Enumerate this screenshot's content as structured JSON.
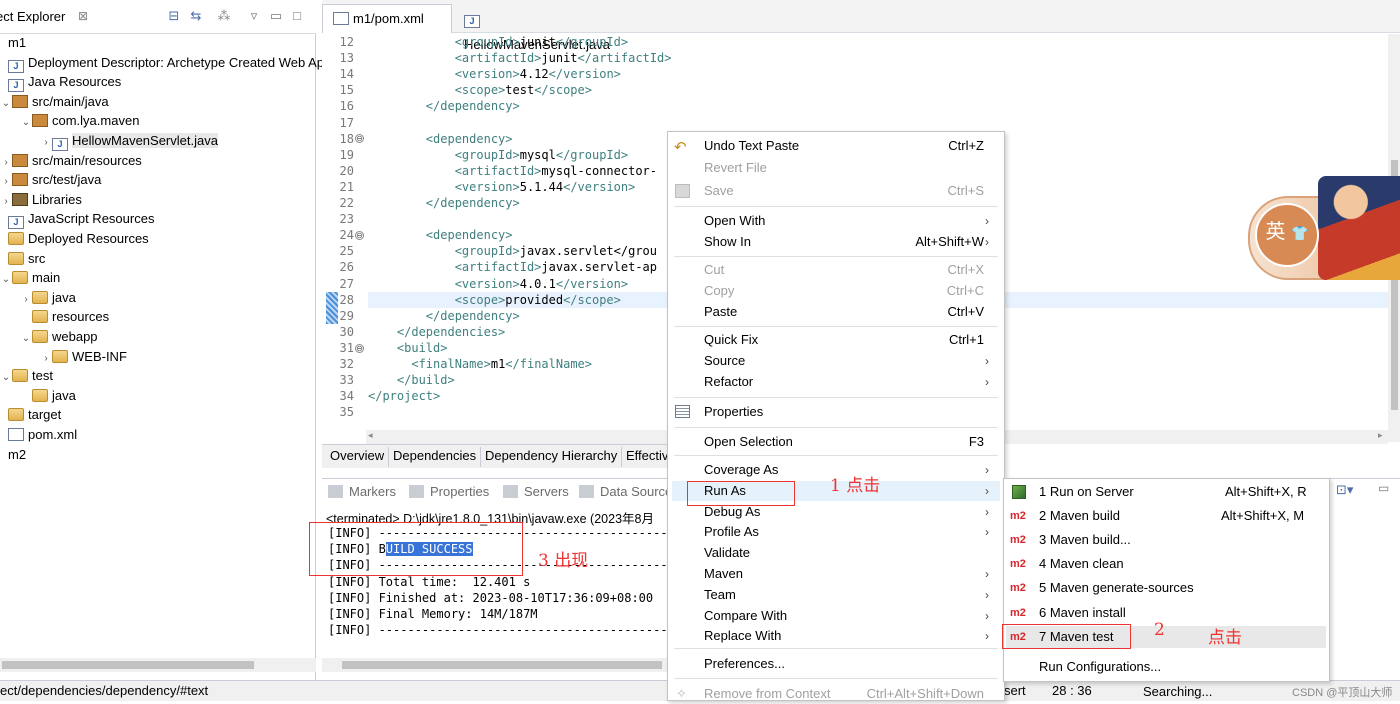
{
  "explorer": {
    "title": "ect Explorer",
    "close": "⊠",
    "tree": [
      {
        "label": "m1",
        "indent": 0,
        "twisty": "",
        "icon": "none"
      },
      {
        "label": "Deployment Descriptor: Archetype Created Web Ap",
        "indent": 0,
        "twisty": "",
        "icon": "jfile"
      },
      {
        "label": "Java Resources",
        "indent": 0,
        "twisty": "",
        "icon": "jfile"
      },
      {
        "label": "src/main/java",
        "indent": 1,
        "twisty": "⌄",
        "icon": "pkg"
      },
      {
        "label": "com.lya.maven",
        "indent": 2,
        "twisty": "⌄",
        "icon": "pkg"
      },
      {
        "label": "HellowMavenServlet.java",
        "indent": 3,
        "twisty": "›",
        "icon": "jfile"
      },
      {
        "label": "src/main/resources",
        "indent": 1,
        "twisty": "›",
        "icon": "pkg"
      },
      {
        "label": "src/test/java",
        "indent": 1,
        "twisty": "›",
        "icon": "pkg"
      },
      {
        "label": "Libraries",
        "indent": 1,
        "twisty": "›",
        "icon": "lib"
      },
      {
        "label": "JavaScript Resources",
        "indent": 0,
        "twisty": "",
        "icon": "jfile"
      },
      {
        "label": "Deployed Resources",
        "indent": 0,
        "twisty": "",
        "icon": "folder"
      },
      {
        "label": "src",
        "indent": 0,
        "twisty": "",
        "icon": "folder"
      },
      {
        "label": "main",
        "indent": 1,
        "twisty": "⌄",
        "icon": "folder"
      },
      {
        "label": "java",
        "indent": 2,
        "twisty": "›",
        "icon": "folder"
      },
      {
        "label": "resources",
        "indent": 2,
        "twisty": "",
        "icon": "folder"
      },
      {
        "label": "webapp",
        "indent": 2,
        "twisty": "⌄",
        "icon": "folder"
      },
      {
        "label": "WEB-INF",
        "indent": 3,
        "twisty": "›",
        "icon": "folder"
      },
      {
        "label": "test",
        "indent": 1,
        "twisty": "⌄",
        "icon": "folder"
      },
      {
        "label": "java",
        "indent": 2,
        "twisty": "",
        "icon": "folder"
      },
      {
        "label": "target",
        "indent": 0,
        "twisty": "",
        "icon": "folder"
      },
      {
        "label": "pom.xml",
        "indent": 0,
        "twisty": "",
        "icon": "xmlf"
      },
      {
        "label": "m2",
        "indent": 0,
        "twisty": "",
        "icon": "none"
      }
    ]
  },
  "editor": {
    "tabs": [
      {
        "label": "m1/pom.xml",
        "active": true
      },
      {
        "label": "HellowMavenServlet.java",
        "active": false
      }
    ],
    "lines": [
      {
        "n": "12",
        "text": "            <groupId>junit</groupId>"
      },
      {
        "n": "13",
        "text": "            <artifactId>junit</artifactId>"
      },
      {
        "n": "14",
        "text": "            <version>4.12</version>"
      },
      {
        "n": "15",
        "text": "            <scope>test</scope>"
      },
      {
        "n": "16",
        "text": "        </dependency>"
      },
      {
        "n": "17",
        "text": ""
      },
      {
        "n": "18",
        "text": "        <dependency>"
      },
      {
        "n": "19",
        "text": "            <groupId>mysql</groupId>"
      },
      {
        "n": "20",
        "text": "            <artifactId>mysql-connector-"
      },
      {
        "n": "21",
        "text": "            <version>5.1.44</version>"
      },
      {
        "n": "22",
        "text": "        </dependency>"
      },
      {
        "n": "23",
        "text": ""
      },
      {
        "n": "24",
        "text": "        <dependency>"
      },
      {
        "n": "25",
        "text": "            <groupId>javax.servlet</grou"
      },
      {
        "n": "26",
        "text": "            <artifactId>javax.servlet-ap"
      },
      {
        "n": "27",
        "text": "            <version>4.0.1</version>"
      },
      {
        "n": "28",
        "text": "            <scope>provided</scope>"
      },
      {
        "n": "29",
        "text": "        </dependency>"
      },
      {
        "n": "30",
        "text": "    </dependencies>"
      },
      {
        "n": "31",
        "text": "    <build>"
      },
      {
        "n": "32",
        "text": "      <finalName>m1</finalName>"
      },
      {
        "n": "33",
        "text": "    </build>"
      },
      {
        "n": "34",
        "text": "</project>"
      },
      {
        "n": "35",
        "text": ""
      }
    ],
    "fold_marker": "⊖",
    "pom_tabs": [
      "Overview",
      "Dependencies",
      "Dependency Hierarchy",
      "Effectiv"
    ]
  },
  "console": {
    "tabs": [
      "Markers",
      "Properties",
      "Servers",
      "Data Source"
    ],
    "path": "<terminated> D:\\jdk\\jre1.8.0_131\\bin\\javaw.exe (2023年8月",
    "lines": [
      {
        "prefix": "[INFO] ",
        "text": "------------------------------------------------------------------------",
        "sel": ""
      },
      {
        "prefix": "[INFO] B",
        "text": "",
        "sel": "UILD SUCCESS"
      },
      {
        "prefix": "[INFO] ",
        "text": "------------------------------------------------------------------------",
        "sel": ""
      },
      {
        "prefix": "[INFO] ",
        "text": "Total time:  12.401 s",
        "sel": ""
      },
      {
        "prefix": "[INFO] ",
        "text": "Finished at: 2023-08-10T17:36:09+08:00",
        "sel": ""
      },
      {
        "prefix": "[INFO] ",
        "text": "Final Memory: 14M/187M",
        "sel": ""
      },
      {
        "prefix": "[INFO] ",
        "text": "------------------------------------------------------------------------",
        "sel": ""
      }
    ]
  },
  "context_menu": {
    "items": [
      {
        "label": "Undo Text Paste",
        "shortcut": "Ctrl+Z",
        "disabled": false,
        "submenu": false
      },
      {
        "label": "Revert File",
        "shortcut": "",
        "disabled": true,
        "submenu": false
      },
      {
        "label": "Save",
        "shortcut": "Ctrl+S",
        "disabled": true,
        "submenu": false
      },
      {
        "label": "Open With",
        "shortcut": "",
        "disabled": false,
        "submenu": true
      },
      {
        "label": "Show In",
        "shortcut": "Alt+Shift+W",
        "disabled": false,
        "submenu": true
      },
      {
        "label": "Cut",
        "shortcut": "Ctrl+X",
        "disabled": true,
        "submenu": false
      },
      {
        "label": "Copy",
        "shortcut": "Ctrl+C",
        "disabled": true,
        "submenu": false
      },
      {
        "label": "Paste",
        "shortcut": "Ctrl+V",
        "disabled": false,
        "submenu": false
      },
      {
        "label": "Quick Fix",
        "shortcut": "Ctrl+1",
        "disabled": false,
        "submenu": false
      },
      {
        "label": "Source",
        "shortcut": "",
        "disabled": false,
        "submenu": true
      },
      {
        "label": "Refactor",
        "shortcut": "",
        "disabled": false,
        "submenu": true
      },
      {
        "label": "Properties",
        "shortcut": "",
        "disabled": false,
        "submenu": false
      },
      {
        "label": "Open Selection",
        "shortcut": "F3",
        "disabled": false,
        "submenu": false
      },
      {
        "label": "Coverage As",
        "shortcut": "",
        "disabled": false,
        "submenu": true
      },
      {
        "label": "Run As",
        "shortcut": "",
        "disabled": false,
        "submenu": true
      },
      {
        "label": "Debug As",
        "shortcut": "",
        "disabled": false,
        "submenu": true
      },
      {
        "label": "Profile As",
        "shortcut": "",
        "disabled": false,
        "submenu": true
      },
      {
        "label": "Validate",
        "shortcut": "",
        "disabled": false,
        "submenu": false
      },
      {
        "label": "Maven",
        "shortcut": "",
        "disabled": false,
        "submenu": true
      },
      {
        "label": "Team",
        "shortcut": "",
        "disabled": false,
        "submenu": true
      },
      {
        "label": "Compare With",
        "shortcut": "",
        "disabled": false,
        "submenu": true
      },
      {
        "label": "Replace With",
        "shortcut": "",
        "disabled": false,
        "submenu": true
      },
      {
        "label": "Preferences...",
        "shortcut": "",
        "disabled": false,
        "submenu": false
      },
      {
        "label": "Remove from Context",
        "shortcut": "Ctrl+Alt+Shift+Down",
        "disabled": true,
        "submenu": false
      }
    ]
  },
  "run_as_submenu": {
    "items": [
      {
        "label": "1 Run on Server",
        "shortcut": "Alt+Shift+X, R",
        "icon": "server"
      },
      {
        "label": "2 Maven build",
        "shortcut": "Alt+Shift+X, M",
        "icon": "m2"
      },
      {
        "label": "3 Maven build...",
        "shortcut": "",
        "icon": "m2"
      },
      {
        "label": "4 Maven clean",
        "shortcut": "",
        "icon": "m2"
      },
      {
        "label": "5 Maven generate-sources",
        "shortcut": "",
        "icon": "m2"
      },
      {
        "label": "6 Maven install",
        "shortcut": "",
        "icon": "m2"
      },
      {
        "label": "7 Maven test",
        "shortcut": "",
        "icon": "m2"
      },
      {
        "label": "Run Configurations...",
        "shortcut": "",
        "icon": "none"
      }
    ],
    "m2_label": "m2"
  },
  "annotations": {
    "step1": "1  点击",
    "step2": "2",
    "step2_text": "点击",
    "step3": "3  出现"
  },
  "avatar": {
    "char": "英"
  },
  "status": {
    "path": "ect/dependencies/dependency/#text",
    "mode": "sert",
    "position": "28 : 36",
    "task": "Searching...",
    "watermark": "CSDN @平顶山大师"
  },
  "colors": {
    "annotation": "#e33333",
    "selection": "#3874d8",
    "tag": "#3f7f7f",
    "m2": "#d9262c"
  }
}
